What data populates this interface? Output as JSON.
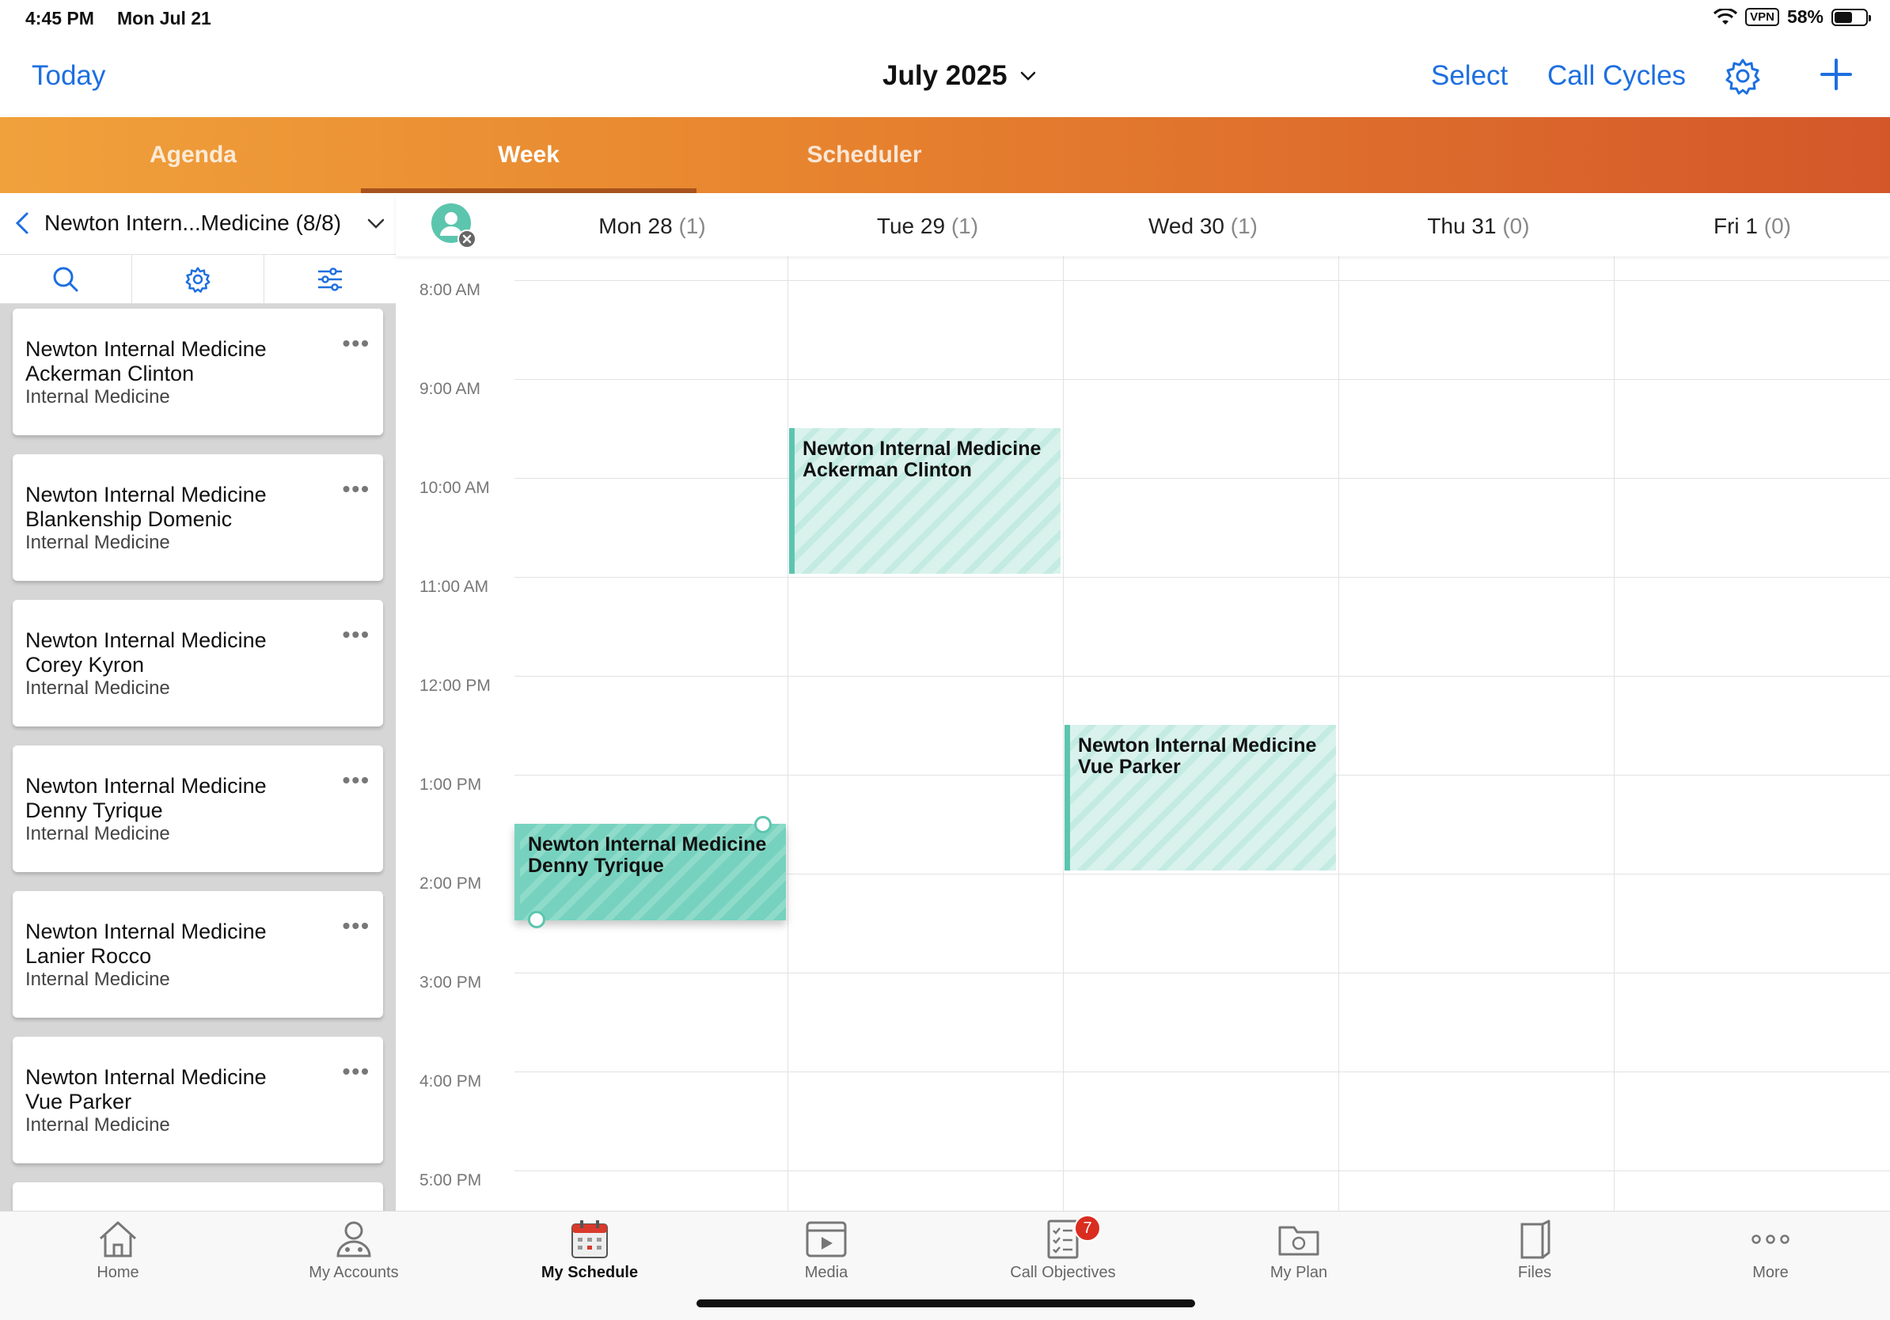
{
  "status_bar": {
    "time": "4:45 PM",
    "date": "Mon Jul 21",
    "vpn": "VPN",
    "battery": "58%"
  },
  "nav": {
    "today": "Today",
    "title": "July 2025",
    "select": "Select",
    "call_cycles": "Call Cycles"
  },
  "tabs": [
    {
      "label": "Agenda"
    },
    {
      "label": "Week"
    },
    {
      "label": "Scheduler"
    }
  ],
  "left_panel": {
    "title": "Newton Intern...Medicine (8/8)",
    "cards": [
      {
        "line1": "Newton Internal Medicine",
        "line2": "Ackerman Clinton",
        "line3": "Internal Medicine"
      },
      {
        "line1": "Newton Internal Medicine",
        "line2": "Blankenship Domenic",
        "line3": "Internal Medicine"
      },
      {
        "line1": "Newton Internal Medicine",
        "line2": "Corey Kyron",
        "line3": "Internal Medicine"
      },
      {
        "line1": "Newton Internal Medicine",
        "line2": "Denny Tyrique",
        "line3": "Internal Medicine"
      },
      {
        "line1": "Newton Internal Medicine",
        "line2": "Lanier Rocco",
        "line3": "Internal Medicine"
      },
      {
        "line1": "Newton Internal Medicine",
        "line2": "Vue Parker",
        "line3": "Internal Medicine"
      }
    ]
  },
  "days": [
    {
      "label": "Mon 28",
      "count": "(1)"
    },
    {
      "label": "Tue 29",
      "count": "(1)"
    },
    {
      "label": "Wed 30",
      "count": "(1)"
    },
    {
      "label": "Thu 31",
      "count": "(0)"
    },
    {
      "label": "Fri 1",
      "count": "(0)"
    }
  ],
  "times": [
    "8:00 AM",
    "9:00 AM",
    "10:00 AM",
    "11:00 AM",
    "12:00 PM",
    "1:00 PM",
    "2:00 PM",
    "3:00 PM",
    "4:00 PM",
    "5:00 PM"
  ],
  "events": [
    {
      "line1": "Newton Internal Medicine",
      "line2": "Ackerman Clinton"
    },
    {
      "line1": "Newton Internal Medicine",
      "line2": "Vue Parker"
    },
    {
      "line1": "Newton Internal Medicine",
      "line2": "Denny Tyrique"
    }
  ],
  "bottom_tabs": [
    {
      "label": "Home",
      "icon": "home-icon"
    },
    {
      "label": "My Accounts",
      "icon": "accounts-icon"
    },
    {
      "label": "My Schedule",
      "icon": "calendar-icon"
    },
    {
      "label": "Media",
      "icon": "media-icon"
    },
    {
      "label": "Call Objectives",
      "icon": "checklist-icon",
      "badge": "7"
    },
    {
      "label": "My Plan",
      "icon": "folder-icon"
    },
    {
      "label": "Files",
      "icon": "files-icon"
    },
    {
      "label": "More",
      "icon": "more-icon"
    }
  ],
  "colors": {
    "accent": "#1d6fe0",
    "event": "#5cc5ae",
    "badge": "#d92d20",
    "tab_gradient_start": "#f0a13c",
    "tab_gradient_end": "#d4572a"
  }
}
